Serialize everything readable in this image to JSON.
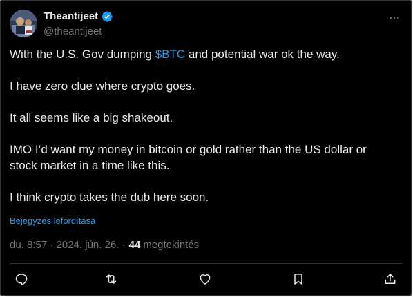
{
  "author": {
    "display_name": "Theantijeet",
    "handle": "@theantijeet",
    "verified": true
  },
  "tweet": {
    "line1_before": "With the U.S. Gov dumping ",
    "line1_cashtag": "$BTC",
    "line1_after": " and potential war ok the way.",
    "body_rest": "\n\nI have zero clue where crypto goes.\n\nIt all seems like a big shakeout.\n\nIMO I’d want my money in bitcoin or gold rather than the US dollar or\nstock market in a time like this.\n\nI think crypto takes the dub here soon.",
    "translate_label": "Bejegyzés lefordítása"
  },
  "meta": {
    "timestamp": "du. 8:57 · 2024. jún. 26. ·",
    "views_count": "44",
    "views_label": "megtekintés"
  },
  "actions": {
    "icons": [
      "reply-icon",
      "retweet-icon",
      "like-icon",
      "bookmark-icon",
      "share-icon"
    ]
  },
  "colors": {
    "background": "#000000",
    "text": "#e7e9ea",
    "secondary": "#71767b",
    "accent": "#1d9bf0",
    "border": "#2f3336"
  }
}
